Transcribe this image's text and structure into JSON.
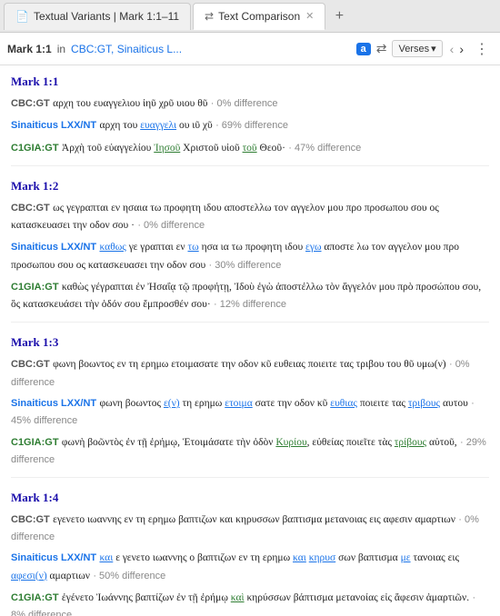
{
  "tabs": [
    {
      "id": "textual-variants",
      "label": "Textual Variants | Mark 1:1–11",
      "icon": "📄",
      "active": false,
      "closeable": false
    },
    {
      "id": "text-comparison",
      "label": "Text Comparison",
      "icon": "⇄",
      "active": true,
      "closeable": true
    }
  ],
  "tab_add_label": "+",
  "address_bar": {
    "ref": "Mark 1:1",
    "in_label": "in",
    "source": "CBC:GT, Sinaiticus L...",
    "badge": "a",
    "icon_switch": "⇄",
    "verses_label": "Verses",
    "nav_back": "‹",
    "nav_forward": "›",
    "more": "⋮"
  },
  "sections": [
    {
      "heading": "Mark 1:1",
      "entries": [
        {
          "source_label": "CBC:GT",
          "source_class": "source-cbc",
          "text": "αρχη του ευαγγελιου ἰηῦ χρῦ υιου θῦ",
          "diff": "0% difference",
          "has_highlights": false
        },
        {
          "source_label": "Sinaiticus LXX/NT",
          "source_class": "source-sinaiticus",
          "text": "αρχη του ○ευαγγελι ου ιῦ χῦ",
          "diff": "69% difference",
          "has_highlights": true
        },
        {
          "source_label": "C1GIA:GT",
          "source_class": "source-c1gia",
          "text": "Ἀρχὴ τοῦ εὐαγγελίου ○Ἰησοῦ Χριστοῦ υἱοῦ ○τοῦ Θεοῦ·",
          "diff": "47% difference",
          "has_highlights": true
        }
      ]
    },
    {
      "heading": "Mark 1:2",
      "entries": [
        {
          "source_label": "CBC:GT",
          "source_class": "source-cbc",
          "text": "ως γεγραπται εν ησαια τω προφητη ιδου αποστελλω τον αγγελον μου προ προσωπου σου ος κατασκευασει την οδον σου ·",
          "diff": "0% difference",
          "has_highlights": false
        },
        {
          "source_label": "Sinaiticus LXX/NT",
          "source_class": "source-sinaiticus",
          "text": "○καθως γε γραπται εν ○τω ησα ια τω προφητη ιδου ○εγω αποστε λω τον αγγελον μου προ προσωπου σου ος κατασκευασει την οδον σου",
          "diff": "30% difference",
          "has_highlights": true
        },
        {
          "source_label": "C1GIA:GT",
          "source_class": "source-c1gia",
          "text": "καθὼς γέγραπται ἐν Ἠσαΐᾳ τῷ προφήτῃ, Ἰδοὺ ἐγὼ ἀποστέλλω τὸν ἄγγελόν μου πρὸ προσώπου σου, ὃς κατασκευάσει τὴν ὁδόν σου ἔμπροσθέν σου·",
          "diff": "12% difference",
          "has_highlights": true
        }
      ]
    },
    {
      "heading": "Mark 1:3",
      "entries": [
        {
          "source_label": "CBC:GT",
          "source_class": "source-cbc",
          "text": "φωνη βοωντος εν τη ερημω ετοιμασατε την οδον κῦ ευθειας ποιειτε τας τριβου του θῦ υμω(ν)",
          "diff": "0% difference",
          "has_highlights": false
        },
        {
          "source_label": "Sinaiticus LXX/NT",
          "source_class": "source-sinaiticus",
          "text": "φωνη βοωντος ○ε(ν) τη ερημω ○ετοιμα σατε την οδον κῦ ○ευθιας ποιειτε τας ○τριβους αυτου",
          "diff": "45% difference",
          "has_highlights": true
        },
        {
          "source_label": "C1GIA:GT",
          "source_class": "source-c1gia",
          "text": "φωνὴ βοῶντὸς ἐν τῇ ἐρήμῳ, Ἑτοιμάσατε τὴν ὁδὸν ○Κυρίου, εὐθείας ποιεῖτε τὰς ○τρίβους αὐτοῦ,",
          "diff": "29% difference",
          "has_highlights": true
        }
      ]
    },
    {
      "heading": "Mark 1:4",
      "entries": [
        {
          "source_label": "CBC:GT",
          "source_class": "source-cbc",
          "text": "εγενετο ιωαννης εν τη ερημω βαπτιζων και κηρυσσων βαπτισμα μετανοιας εις αφεσιν αμαρτιων",
          "diff": "0% difference",
          "has_highlights": false
        },
        {
          "source_label": "Sinaiticus LXX/NT",
          "source_class": "source-sinaiticus",
          "text": "○και ε γενετο ιωαννης ο βαπτιζων εν τη ερημω ○και ○κηρυσ σων βαπτισμα ○με τανοιας εις ○αφεσι(ν) αμαρτιων",
          "diff": "50% difference",
          "has_highlights": true
        },
        {
          "source_label": "C1GIA:GT",
          "source_class": "source-c1gia",
          "text": "ἐγένετο Ἰωάννης βαπτίζων ἐν τῇ ἐρήμῳ ○καὶ κηρύσσων βάπτισμα μετανοίας εἰς ἄφεσιν ἁμαρτιῶν.",
          "diff": "8% difference",
          "has_highlights": true
        }
      ]
    }
  ]
}
